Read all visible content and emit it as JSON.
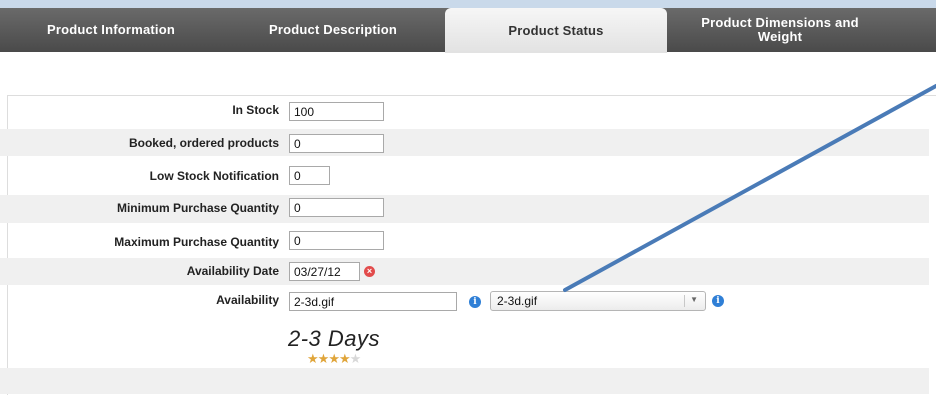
{
  "tabs": [
    {
      "label": "Product Information",
      "active": false
    },
    {
      "label": "Product Description",
      "active": false
    },
    {
      "label": "Product Status",
      "active": true
    },
    {
      "label": "Product Dimensions and Weight",
      "active": false
    }
  ],
  "form": {
    "in_stock": {
      "label": "In Stock",
      "value": "100"
    },
    "booked": {
      "label": "Booked, ordered products",
      "value": "0"
    },
    "low_stock": {
      "label": "Low Stock Notification",
      "value": "0"
    },
    "min_qty": {
      "label": "Minimum Purchase Quantity",
      "value": "0"
    },
    "max_qty": {
      "label": "Maximum Purchase Quantity",
      "value": "0"
    },
    "availability_date": {
      "label": "Availability Date",
      "value": "03/27/12"
    },
    "availability": {
      "label": "Availability",
      "image_value": "2-3d.gif",
      "selected_option": "2-3d.gif",
      "preview_text": "2-3 Days",
      "rating": 4,
      "rating_max": 5
    }
  },
  "icons": {
    "clear": "clear-icon",
    "info": "info-icon",
    "dropdown": "chevron-down-icon",
    "star": "star-icon"
  },
  "colors": {
    "tabbar": "#555555",
    "active_tab": "#eeeeee",
    "row_shade": "#f0f0f0",
    "info_blue": "#2f7fd6",
    "clear_red": "#e24b4b",
    "star_gold": "#e0a53a",
    "pointer_line": "#4a7bb7"
  }
}
